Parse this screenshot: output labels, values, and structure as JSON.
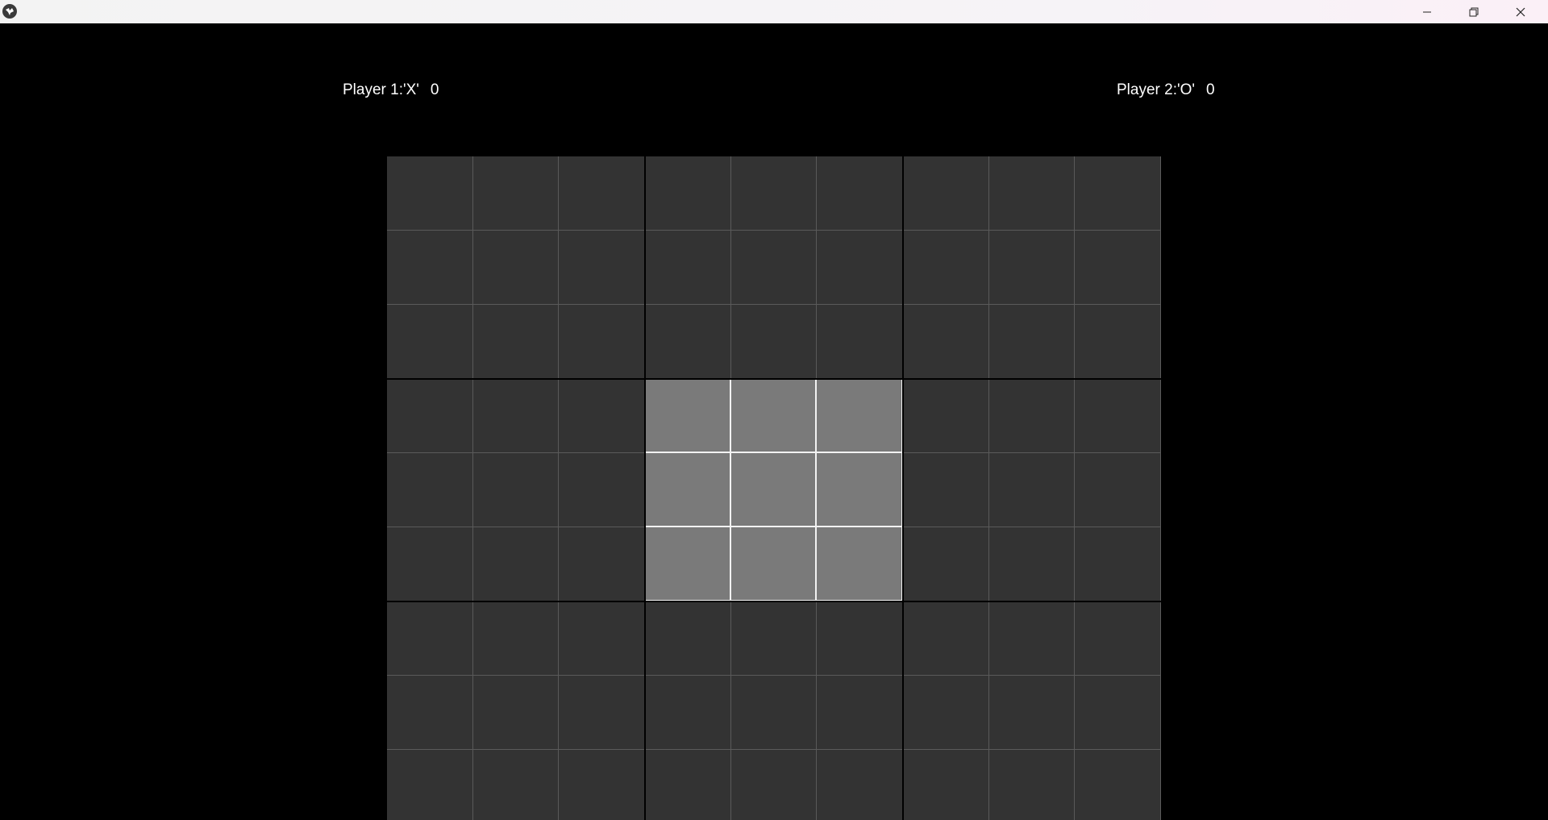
{
  "window": {
    "icon": "kivy-logo-icon",
    "controls": [
      "minimize-icon",
      "restore-icon",
      "close-icon"
    ]
  },
  "scoreboard": {
    "player1": {
      "label": "Player 1:'X'",
      "score": "0"
    },
    "player2": {
      "label": "Player 2:'O'",
      "score": "0"
    }
  },
  "board": {
    "size": 9,
    "visible_rows": 9,
    "active_subgrid": {
      "row": 1,
      "col": 1
    },
    "cells": [
      [
        "",
        "",
        "",
        "",
        "",
        "",
        "",
        "",
        ""
      ],
      [
        "",
        "",
        "",
        "",
        "",
        "",
        "",
        "",
        ""
      ],
      [
        "",
        "",
        "",
        "",
        "",
        "",
        "",
        "",
        ""
      ],
      [
        "",
        "",
        "",
        "",
        "",
        "",
        "",
        "",
        ""
      ],
      [
        "",
        "",
        "",
        "",
        "",
        "",
        "",
        "",
        ""
      ],
      [
        "",
        "",
        "",
        "",
        "",
        "",
        "",
        "",
        ""
      ],
      [
        "",
        "",
        "",
        "",
        "",
        "",
        "",
        "",
        ""
      ],
      [
        "",
        "",
        "",
        "",
        "",
        "",
        "",
        "",
        ""
      ],
      [
        "",
        "",
        "",
        "",
        "",
        "",
        "",
        "",
        ""
      ]
    ],
    "colors": {
      "background": "#000000",
      "cell": "#333333",
      "active_cell": "#7a7a7a",
      "grid_line": "#5a5a5a",
      "active_line": "#f2f2f2",
      "subgrid_line": "#000000"
    }
  }
}
